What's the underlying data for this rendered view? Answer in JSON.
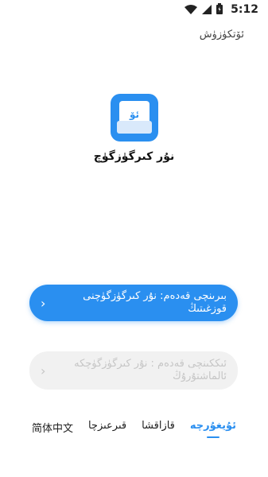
{
  "status_bar": {
    "time": "5:12",
    "icons": [
      "wifi-icon",
      "signal-icon",
      "battery-icon"
    ]
  },
  "header": {
    "skip": "ئۆتكۈزۈش"
  },
  "app": {
    "icon_glyph": "ئۆ",
    "name": "نۇر كىرگۈزگۈچ"
  },
  "steps": [
    {
      "label": "بىرىنچى قەدەم: نۇر كىرگۈزگۈچنى قوزغىتىڭ",
      "state": "active"
    },
    {
      "label": "ئىككىنچى قەدەم : نۇر كىرگۈزگۈچكە ئالماشتۇرۇڭ",
      "state": "disabled"
    }
  ],
  "languages": [
    {
      "label": "简体中文",
      "selected": false
    },
    {
      "label": "قىرعىزچا",
      "selected": false
    },
    {
      "label": "قازاقشا",
      "selected": false
    },
    {
      "label": "ئۇيغۇرچە",
      "selected": true
    }
  ],
  "colors": {
    "accent": "#2a8ff0",
    "disabled_bg": "#f1f1f1",
    "disabled_text": "#c6c6c6"
  }
}
